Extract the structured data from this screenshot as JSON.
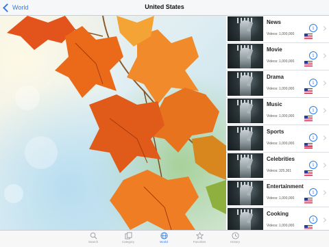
{
  "nav": {
    "back_label": "World",
    "title": "United States"
  },
  "categories": [
    {
      "name": "News",
      "videos": "Videos: 1,000,000"
    },
    {
      "name": "Movie",
      "videos": "Videos: 1,000,000"
    },
    {
      "name": "Drama",
      "videos": "Videos: 1,000,000"
    },
    {
      "name": "Music",
      "videos": "Videos: 1,000,000"
    },
    {
      "name": "Sports",
      "videos": "Videos: 1,000,000"
    },
    {
      "name": "Celebrities",
      "videos": "Videos: 325,361"
    },
    {
      "name": "Entertainment",
      "videos": "Videos: 1,000,000"
    },
    {
      "name": "Cooking",
      "videos": "Videos: 1,000,000"
    }
  ],
  "tabs": [
    {
      "label": "Search",
      "icon": "search-icon"
    },
    {
      "label": "Category",
      "icon": "category-icon"
    },
    {
      "label": "World",
      "icon": "globe-icon",
      "active": true
    },
    {
      "label": "Favorites",
      "icon": "star-icon"
    },
    {
      "label": "History",
      "icon": "clock-icon"
    }
  ],
  "colors": {
    "accent": "#2a7af2",
    "inactive_tab": "#9a9a9f",
    "flag_red": "#c8102e",
    "flag_blue": "#2c3e8f"
  }
}
